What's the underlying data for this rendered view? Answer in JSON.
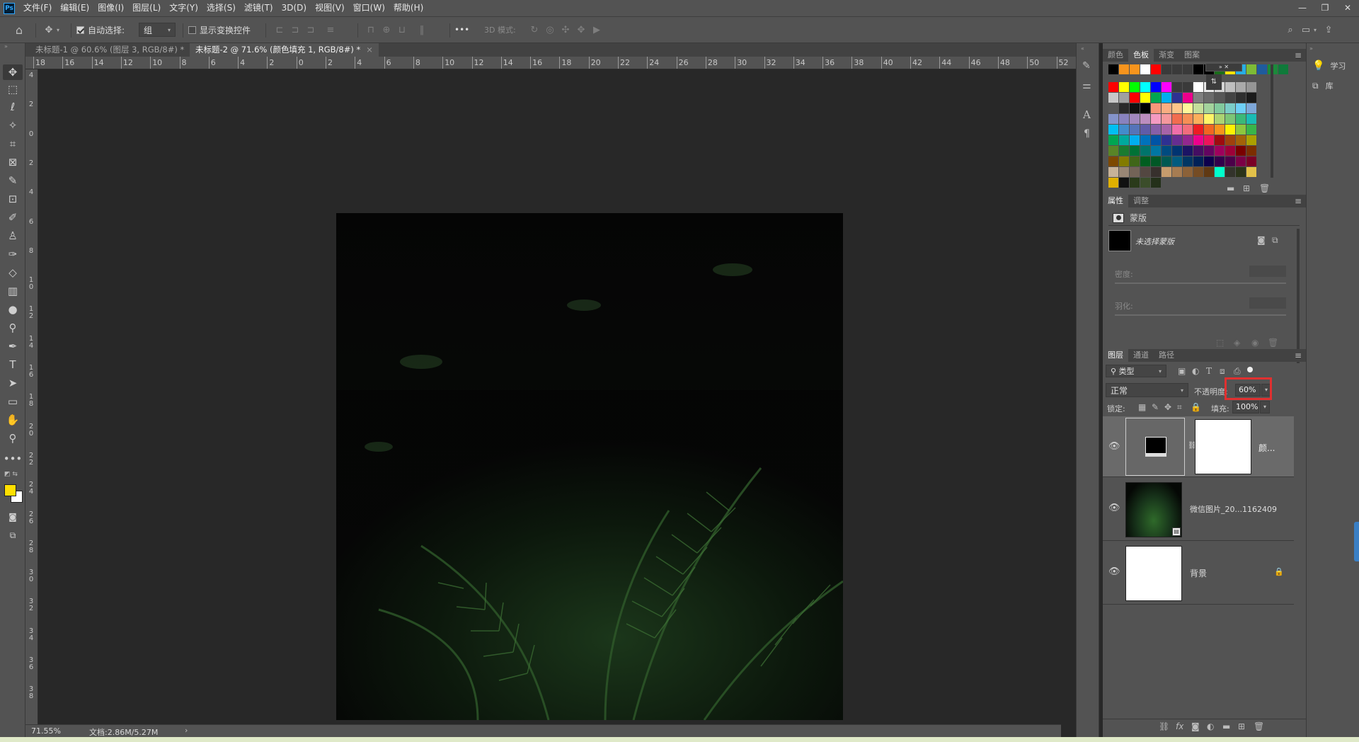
{
  "menubar": {
    "logo": "Ps",
    "items": [
      "文件(F)",
      "编辑(E)",
      "图像(I)",
      "图层(L)",
      "文字(Y)",
      "选择(S)",
      "滤镜(T)",
      "3D(D)",
      "视图(V)",
      "窗口(W)",
      "帮助(H)"
    ],
    "window_controls": [
      "—",
      "❐",
      "✕"
    ]
  },
  "options": {
    "auto_select_label": "自动选择:",
    "auto_select_checked": true,
    "auto_select_value": "组",
    "show_transform_label": "显示变换控件",
    "show_transform_checked": false,
    "mode_3d_label": "3D 模式:",
    "more": "•••"
  },
  "tabs": [
    {
      "label": "未标题-1 @ 60.6% (图层 3, RGB/8#) *",
      "active": false
    },
    {
      "label": "未标题-2 @ 71.6% (颜色填充 1, RGB/8#) *",
      "active": true
    }
  ],
  "ruler": {
    "top_labels": [
      "18",
      "16",
      "14",
      "12",
      "10",
      "8",
      "6",
      "4",
      "2",
      "0",
      "2",
      "4",
      "6",
      "8",
      "10",
      "12",
      "14",
      "16",
      "18",
      "20",
      "22",
      "24",
      "26",
      "28",
      "30",
      "32",
      "34",
      "36",
      "38",
      "40",
      "42",
      "44",
      "46",
      "48",
      "50",
      "52"
    ],
    "left_labels": [
      "4",
      "2",
      "0",
      "2",
      "4",
      "6",
      "8",
      "10",
      "12",
      "14",
      "16",
      "18",
      "20",
      "22",
      "24",
      "26",
      "28",
      "30",
      "32",
      "34",
      "36",
      "38"
    ]
  },
  "status": {
    "zoom": "71.55%",
    "doc": "文档:2.86M/5.27M",
    "arrow": "›"
  },
  "swatches_panel": {
    "tabs": [
      "颜色",
      "色板",
      "渐变",
      "图案"
    ],
    "active_tab": "色板"
  },
  "properties_panel": {
    "tabs": [
      "属性",
      "调整"
    ],
    "active_tab": "属性",
    "section": "蒙版",
    "mask_label": "未选择蒙版",
    "density_label": "密度:",
    "feather_label": "羽化:"
  },
  "layers_panel": {
    "tabs": [
      "图层",
      "通道",
      "路径"
    ],
    "active_tab": "图层",
    "filter_label": "类型",
    "blend_mode": "正常",
    "opacity_label": "不透明度:",
    "opacity_value": "60%",
    "lock_label": "锁定:",
    "fill_label": "填充:",
    "fill_value": "100%",
    "layers": [
      {
        "name": "颜...",
        "type": "fill"
      },
      {
        "name": "微信图片_20...1162409",
        "type": "image"
      },
      {
        "name": "背景",
        "type": "background"
      }
    ]
  },
  "far_right": {
    "learn_label": "学习",
    "library_label": "库"
  },
  "colors": {
    "highlight": "#e03030",
    "foreground": "#ffe000",
    "background": "#ffffff"
  }
}
